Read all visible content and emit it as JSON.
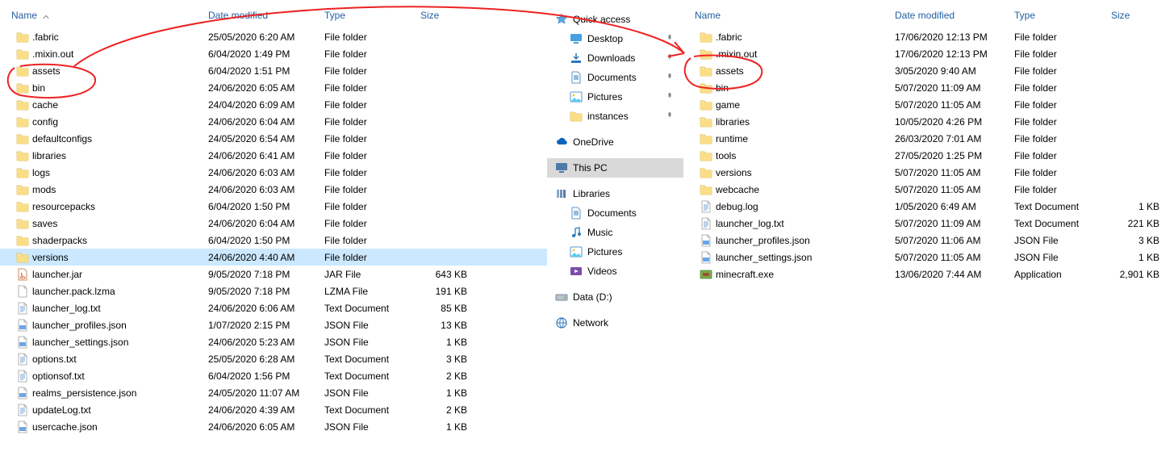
{
  "headers": {
    "name": "Name",
    "date": "Date modified",
    "type": "Type",
    "size": "Size"
  },
  "left": {
    "rows": [
      {
        "icon": "folder",
        "name": ".fabric",
        "date": "25/05/2020 6:20 AM",
        "type": "File folder",
        "size": ""
      },
      {
        "icon": "folder",
        "name": ".mixin.out",
        "date": "6/04/2020 1:49 PM",
        "type": "File folder",
        "size": ""
      },
      {
        "icon": "folder",
        "name": "assets",
        "date": "6/04/2020 1:51 PM",
        "type": "File folder",
        "size": ""
      },
      {
        "icon": "folder",
        "name": "bin",
        "date": "24/06/2020 6:05 AM",
        "type": "File folder",
        "size": ""
      },
      {
        "icon": "folder",
        "name": "cache",
        "date": "24/04/2020 6:09 AM",
        "type": "File folder",
        "size": ""
      },
      {
        "icon": "folder",
        "name": "config",
        "date": "24/06/2020 6:04 AM",
        "type": "File folder",
        "size": ""
      },
      {
        "icon": "folder",
        "name": "defaultconfigs",
        "date": "24/05/2020 6:54 AM",
        "type": "File folder",
        "size": ""
      },
      {
        "icon": "folder",
        "name": "libraries",
        "date": "24/06/2020 6:41 AM",
        "type": "File folder",
        "size": ""
      },
      {
        "icon": "folder",
        "name": "logs",
        "date": "24/06/2020 6:03 AM",
        "type": "File folder",
        "size": ""
      },
      {
        "icon": "folder",
        "name": "mods",
        "date": "24/06/2020 6:03 AM",
        "type": "File folder",
        "size": ""
      },
      {
        "icon": "folder",
        "name": "resourcepacks",
        "date": "6/04/2020 1:50 PM",
        "type": "File folder",
        "size": ""
      },
      {
        "icon": "folder",
        "name": "saves",
        "date": "24/06/2020 6:04 AM",
        "type": "File folder",
        "size": ""
      },
      {
        "icon": "folder",
        "name": "shaderpacks",
        "date": "6/04/2020 1:50 PM",
        "type": "File folder",
        "size": ""
      },
      {
        "icon": "folder",
        "name": "versions",
        "date": "24/06/2020 4:40 AM",
        "type": "File folder",
        "size": "",
        "selected": true
      },
      {
        "icon": "jar",
        "name": "launcher.jar",
        "date": "9/05/2020 7:18 PM",
        "type": "JAR File",
        "size": "643 KB"
      },
      {
        "icon": "file",
        "name": "launcher.pack.lzma",
        "date": "9/05/2020 7:18 PM",
        "type": "LZMA File",
        "size": "191 KB"
      },
      {
        "icon": "text",
        "name": "launcher_log.txt",
        "date": "24/06/2020 6:06 AM",
        "type": "Text Document",
        "size": "85 KB"
      },
      {
        "icon": "json",
        "name": "launcher_profiles.json",
        "date": "1/07/2020 2:15 PM",
        "type": "JSON File",
        "size": "13 KB"
      },
      {
        "icon": "json",
        "name": "launcher_settings.json",
        "date": "24/06/2020 5:23 AM",
        "type": "JSON File",
        "size": "1 KB"
      },
      {
        "icon": "text",
        "name": "options.txt",
        "date": "25/05/2020 6:28 AM",
        "type": "Text Document",
        "size": "3 KB"
      },
      {
        "icon": "text",
        "name": "optionsof.txt",
        "date": "6/04/2020 1:56 PM",
        "type": "Text Document",
        "size": "2 KB"
      },
      {
        "icon": "json",
        "name": "realms_persistence.json",
        "date": "24/05/2020 11:07 AM",
        "type": "JSON File",
        "size": "1 KB"
      },
      {
        "icon": "text",
        "name": "updateLog.txt",
        "date": "24/06/2020 4:39 AM",
        "type": "Text Document",
        "size": "2 KB"
      },
      {
        "icon": "json",
        "name": "usercache.json",
        "date": "24/06/2020 6:05 AM",
        "type": "JSON File",
        "size": "1 KB"
      }
    ]
  },
  "nav": {
    "quick_access": "Quick access",
    "desktop": "Desktop",
    "downloads": "Downloads",
    "documents": "Documents",
    "pictures": "Pictures",
    "instances": "instances",
    "onedrive": "OneDrive",
    "thispc": "This PC",
    "libraries": "Libraries",
    "lib_documents": "Documents",
    "lib_music": "Music",
    "lib_pictures": "Pictures",
    "lib_videos": "Videos",
    "data_d": "Data (D:)",
    "network": "Network"
  },
  "right": {
    "rows": [
      {
        "icon": "folder",
        "name": ".fabric",
        "date": "17/06/2020 12:13 PM",
        "type": "File folder",
        "size": ""
      },
      {
        "icon": "folder",
        "name": ".mixin.out",
        "date": "17/06/2020 12:13 PM",
        "type": "File folder",
        "size": ""
      },
      {
        "icon": "folder",
        "name": "assets",
        "date": "3/05/2020 9:40 AM",
        "type": "File folder",
        "size": ""
      },
      {
        "icon": "folder",
        "name": "bin",
        "date": "5/07/2020 11:09 AM",
        "type": "File folder",
        "size": ""
      },
      {
        "icon": "folder",
        "name": "game",
        "date": "5/07/2020 11:05 AM",
        "type": "File folder",
        "size": ""
      },
      {
        "icon": "folder",
        "name": "libraries",
        "date": "10/05/2020 4:26 PM",
        "type": "File folder",
        "size": ""
      },
      {
        "icon": "folder",
        "name": "runtime",
        "date": "26/03/2020 7:01 AM",
        "type": "File folder",
        "size": ""
      },
      {
        "icon": "folder",
        "name": "tools",
        "date": "27/05/2020 1:25 PM",
        "type": "File folder",
        "size": ""
      },
      {
        "icon": "folder",
        "name": "versions",
        "date": "5/07/2020 11:05 AM",
        "type": "File folder",
        "size": ""
      },
      {
        "icon": "folder",
        "name": "webcache",
        "date": "5/07/2020 11:05 AM",
        "type": "File folder",
        "size": ""
      },
      {
        "icon": "text",
        "name": "debug.log",
        "date": "1/05/2020 6:49 AM",
        "type": "Text Document",
        "size": "1 KB"
      },
      {
        "icon": "text",
        "name": "launcher_log.txt",
        "date": "5/07/2020 11:09 AM",
        "type": "Text Document",
        "size": "221 KB"
      },
      {
        "icon": "json",
        "name": "launcher_profiles.json",
        "date": "5/07/2020 11:06 AM",
        "type": "JSON File",
        "size": "3 KB"
      },
      {
        "icon": "json",
        "name": "launcher_settings.json",
        "date": "5/07/2020 11:05 AM",
        "type": "JSON File",
        "size": "1 KB"
      },
      {
        "icon": "exe",
        "name": "minecraft.exe",
        "date": "13/06/2020 7:44 AM",
        "type": "Application",
        "size": "2,901 KB"
      }
    ]
  }
}
